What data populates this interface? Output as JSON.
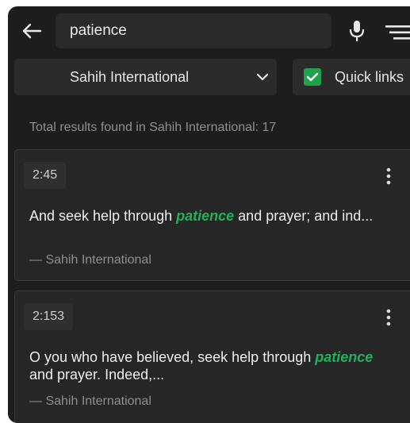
{
  "search": {
    "value": "patience"
  },
  "translation": {
    "selected": "Sahih International"
  },
  "quick_links": {
    "label": "Quick links",
    "checked": true,
    "color": "#1fa14e"
  },
  "results": {
    "summary": "Total results found in Sahih International: 17",
    "highlight_color": "#21b15a",
    "items": [
      {
        "reference": "2:45",
        "before": "And seek help through ",
        "match": "patience",
        "after": " and prayer; and ind...",
        "source": "— Sahih International"
      },
      {
        "reference": "2:153",
        "before": "O you who have believed, seek help through ",
        "match": "patience",
        "after": " and prayer. Indeed,...",
        "source": "— Sahih International"
      }
    ]
  },
  "icons": {
    "back": "arrow-left-icon",
    "mic": "microphone-icon",
    "filter": "filter-icon",
    "dropdown": "chevron-down-icon",
    "more": "kebab-menu-icon"
  }
}
